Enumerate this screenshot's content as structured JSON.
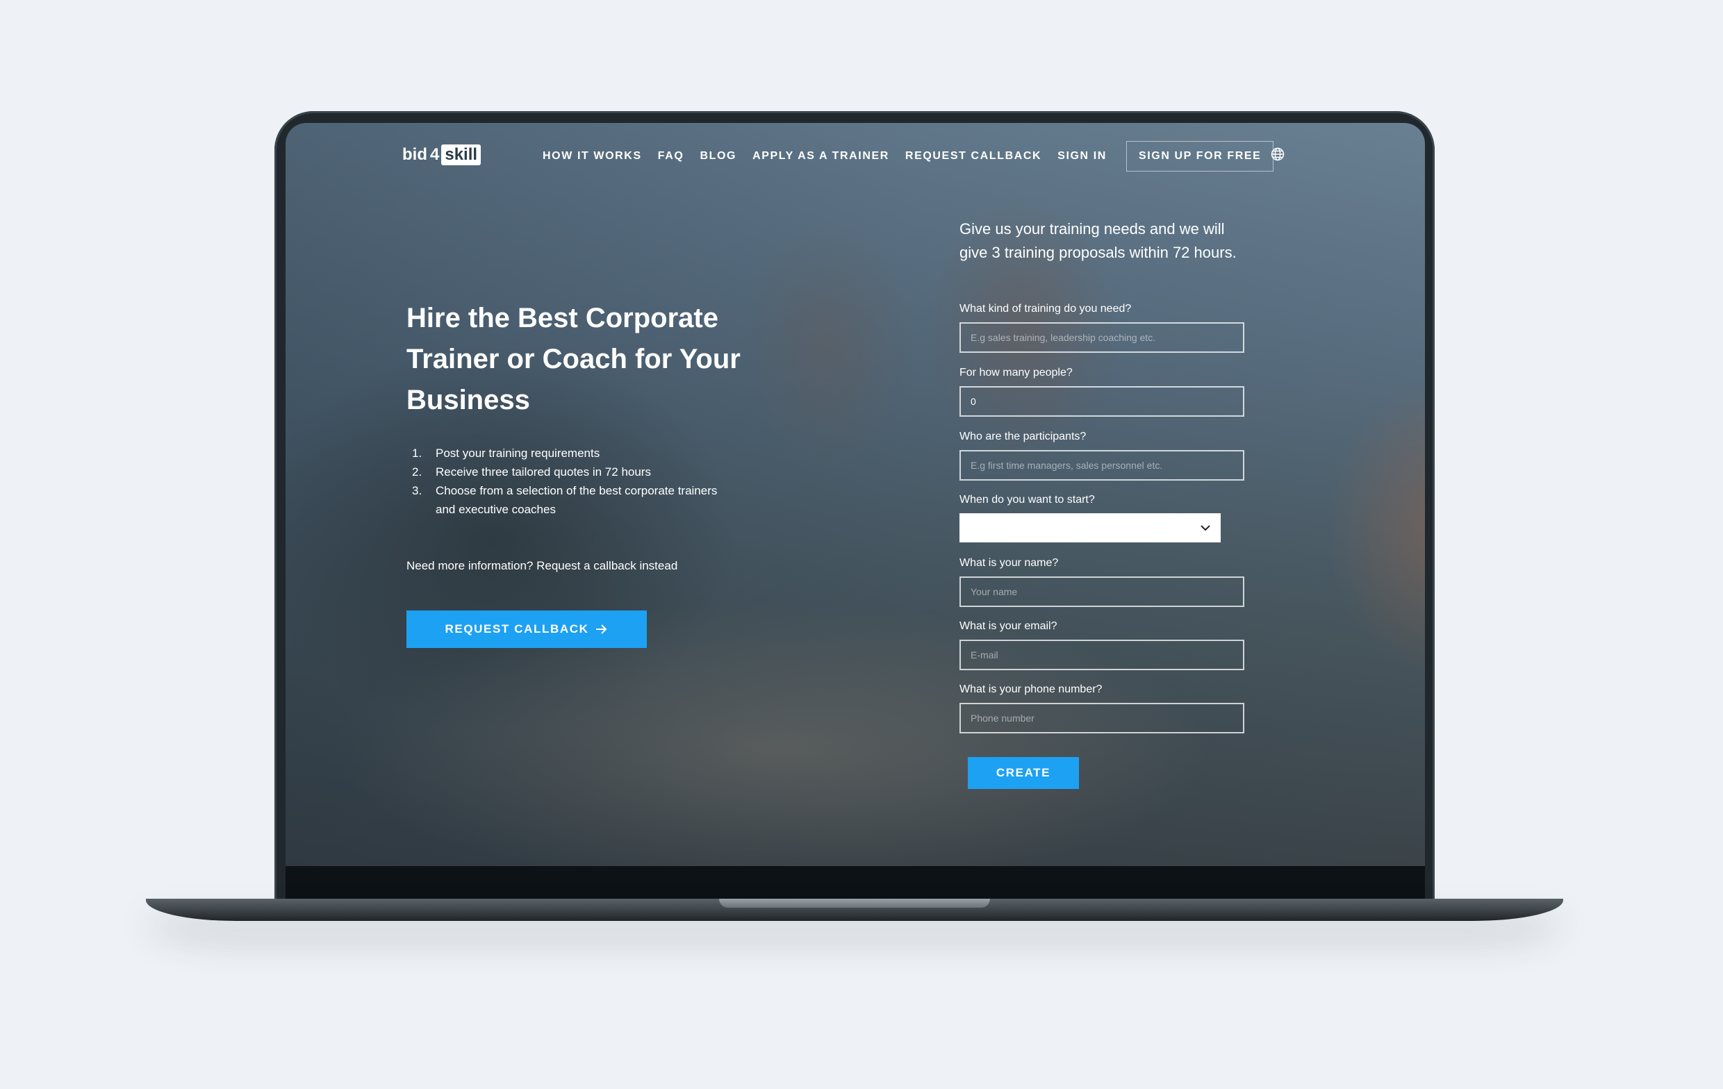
{
  "nav": {
    "logo": {
      "text1": "bid",
      "text2": "4",
      "text3": "skill"
    },
    "links": [
      "HOW IT WORKS",
      "FAQ",
      "BLOG",
      "APPLY AS A TRAINER",
      "REQUEST CALLBACK",
      "SIGN IN"
    ],
    "signup": "SIGN UP FOR FREE",
    "icon": "globe-icon"
  },
  "hero": {
    "title": "Hire the Best Corporate Trainer or Coach for Your Business",
    "steps": [
      {
        "num": "1.",
        "text": "Post your training requirements"
      },
      {
        "num": "2.",
        "text": "Receive three tailored quotes in 72 hours"
      },
      {
        "num": "3.",
        "text": "Choose from a selection of the best corporate trainers and executive coaches"
      }
    ],
    "more_info": "Need more information? Request a callback instead",
    "callback_button": "REQUEST CALLBACK",
    "callback_icon": "arrow-right-icon"
  },
  "form": {
    "intro": "Give us your training needs and we will give 3 training proposals within 72 hours.",
    "training": {
      "label": "What kind of training do you need?",
      "placeholder": "E.g sales training, leadership coaching etc."
    },
    "people": {
      "label": "For how many people?",
      "value": "0"
    },
    "participants": {
      "label": "Who are the participants?",
      "placeholder": "E.g first time managers, sales personnel etc."
    },
    "start": {
      "label": "When do you want to start?",
      "value": ""
    },
    "name": {
      "label": "What is your name?",
      "placeholder": "Your name"
    },
    "email": {
      "label": "What is your email?",
      "placeholder": "E-mail"
    },
    "phone": {
      "label": "What is your phone number?",
      "placeholder": "Phone number"
    },
    "create_button": "CREATE"
  },
  "colors": {
    "accent": "#1da1f2",
    "page_bg": "#eef2f6",
    "laptop": "#20272d"
  }
}
